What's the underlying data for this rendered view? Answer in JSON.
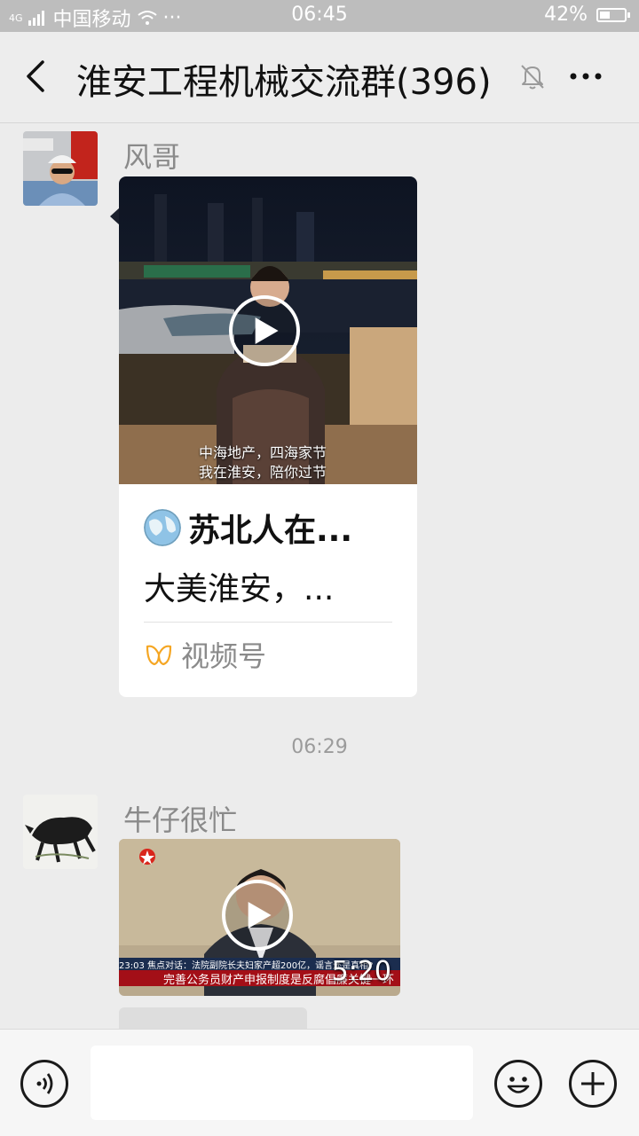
{
  "status_bar": {
    "network": "4G",
    "carrier": "中国移动",
    "dots": "···",
    "time": "06:45",
    "battery_text": "42%",
    "battery_level": 0.42
  },
  "header": {
    "title": "淮安工程机械交流群(396)",
    "back_icon": "chevron-left-icon",
    "mute_icon": "bell-off-icon",
    "more_icon": "more-horizontal-icon"
  },
  "messages": [
    {
      "sender": "风哥",
      "type": "channels-video",
      "video_caption_lines": [
        "中海地产，四海家节",
        "我在淮安，陪你过节"
      ],
      "channel_name": "苏北人在...",
      "description": "大美淮安，...",
      "source_label": "视频号"
    },
    {
      "sender": "牛仔很忙",
      "type": "video",
      "duration": "5:20",
      "ticker_top": "焦点对话：法院副院长夫妇家产超200亿，谣言还是真相?",
      "ticker_time": "23:03",
      "ticker_bottom": "完善公务员财产申报制度是反腐倡廉关键一环"
    }
  ],
  "timestamp": "06:29",
  "colors": {
    "background": "#ececec",
    "status_bar": "#bdbdbd",
    "bubble": "#ffffff",
    "channels_icon": "#f5a623"
  }
}
